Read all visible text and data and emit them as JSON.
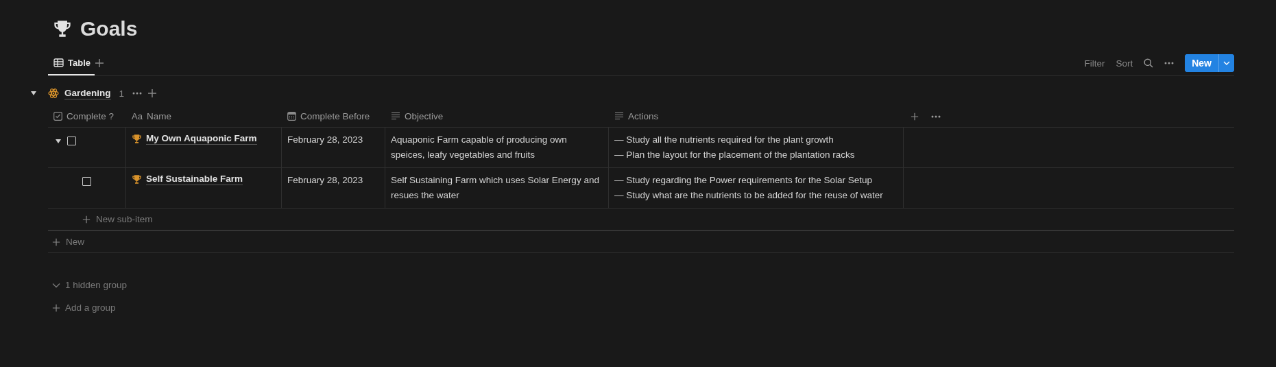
{
  "page": {
    "title": "Goals"
  },
  "views": [
    {
      "label": "Table",
      "selected": true
    }
  ],
  "toolbar": {
    "filter": "Filter",
    "sort": "Sort",
    "new_button": "New"
  },
  "group": {
    "name": "Gardening",
    "count": "1",
    "expanded": true,
    "columns": [
      {
        "label": "Complete ?",
        "kind": "checkbox"
      },
      {
        "label": "Name",
        "kind": "title",
        "type_label": "Aa"
      },
      {
        "label": "Complete Before",
        "kind": "date"
      },
      {
        "label": "Objective",
        "kind": "text"
      },
      {
        "label": "Actions",
        "kind": "text"
      }
    ],
    "rows": [
      {
        "checked": false,
        "expanded": true,
        "name": "My Own Aquaponic Farm",
        "date": "February 28, 2023",
        "objective": "Aquaponic Farm capable of producing own speices, leafy vegetables and fruits",
        "actions": [
          "— Study all the nutrients required for the plant growth",
          "— Plan the layout for the placement of the plantation racks"
        ],
        "children": [
          {
            "checked": false,
            "name": "Self Sustainable Farm",
            "date": "February 28, 2023",
            "objective": "Self Sustaining Farm which uses Solar Energy and resues the water",
            "actions": [
              "— Study regarding the Power requirements for the Solar Setup",
              "— Study what are the nutrients to be added for the reuse of water"
            ]
          }
        ]
      }
    ],
    "new_sub_item": "New sub-item",
    "new_row": "New"
  },
  "hidden_groups": "1 hidden group",
  "add_group": "Add a group"
}
